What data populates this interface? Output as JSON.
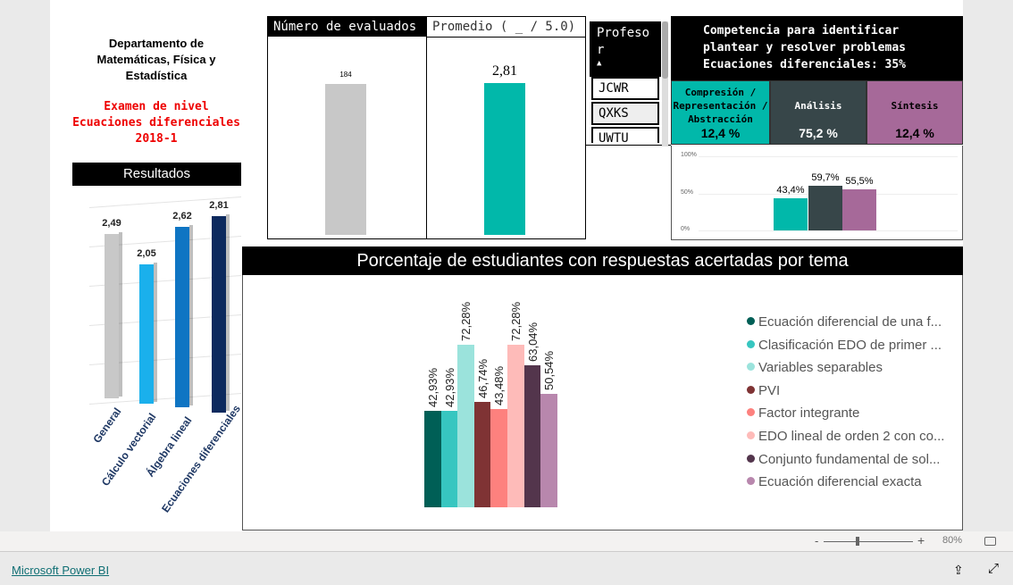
{
  "department": {
    "line1": "Departamento de",
    "line2": "Matemáticas, Física y",
    "line3": "Estadística"
  },
  "exam": {
    "line1": "Examen de nivel",
    "line2": "Ecuaciones diferenciales",
    "line3": "2018-1"
  },
  "results": {
    "title": "Resultados",
    "categories": [
      "General",
      "Cálculo vectorial",
      "Álgebra lineal",
      "Ecuaciones diferenciales"
    ],
    "values": [
      2.49,
      2.05,
      2.62,
      2.81
    ],
    "labels": [
      "2,49",
      "2,05",
      "2,62",
      "2,81"
    ],
    "colors": [
      "#c8c8c8",
      "#1ab0ec",
      "#0f75c3",
      "#0d2a5e"
    ]
  },
  "evaluated": {
    "title": "Número de evaluados",
    "value": "184",
    "color": "#c8c8c8"
  },
  "average": {
    "title": "Promedio ( _ / 5.0)",
    "value": "2,81",
    "color": "#01b8aa"
  },
  "slicer": {
    "title": "Profesor",
    "title_wrap1": "Profeso",
    "title_wrap2": "r",
    "items": [
      "JCWR",
      "QXKS",
      "UWTU"
    ]
  },
  "competence": {
    "line1": "Competencia para identificar",
    "line2": "plantear y resolver problemas",
    "line3": "Ecuaciones diferenciales: 35%",
    "cells": [
      {
        "label": "Compresión / Representación / Abstracción",
        "pct": "12,4 %",
        "color": "#01b8aa"
      },
      {
        "label": "Análisis",
        "pct": "75,2 %",
        "color": "#374649"
      },
      {
        "label": "Síntesis",
        "pct": "12,4 %",
        "color": "#a66999"
      }
    ]
  },
  "chart_data": [
    {
      "type": "bar",
      "categories": [
        "General",
        "Cálculo vectorial",
        "Álgebra lineal",
        "Ecuaciones diferenciales"
      ],
      "values": [
        2.49,
        2.05,
        2.62,
        2.81
      ],
      "title": "Resultados"
    },
    {
      "type": "bar",
      "categories": [
        "Compresión / Representación / Abstracción",
        "Análisis",
        "Síntesis"
      ],
      "values": [
        43.4,
        59.7,
        55.5
      ],
      "labels": [
        "43,4%",
        "59,7%",
        "55,5%"
      ],
      "yticks": [
        "0%",
        "50%",
        "100%"
      ],
      "ylim": [
        0,
        100
      ],
      "colors": [
        "#01b8aa",
        "#374649",
        "#a66999"
      ]
    },
    {
      "type": "bar",
      "title": "Porcentaje de estudiantes con respuestas acertadas por tema",
      "legend": "right",
      "series": [
        {
          "name": "Ecuación diferencial de una f...",
          "value": 42.93,
          "label": "42,93%",
          "color": "#005f56"
        },
        {
          "name": "Clasificación EDO de primer ...",
          "value": 42.93,
          "label": "42,93%",
          "color": "#37c6c0"
        },
        {
          "name": "Variables separables",
          "value": 72.28,
          "label": "72,28%",
          "color": "#9be3dc"
        },
        {
          "name": "PVI",
          "value": 46.74,
          "label": "46,74%",
          "color": "#7f3334"
        },
        {
          "name": "Factor integrante",
          "value": 43.48,
          "label": "43,48%",
          "color": "#fd817e"
        },
        {
          "name": "EDO lineal de orden 2 con co...",
          "value": 72.28,
          "label": "72,28%",
          "color": "#febbb9"
        },
        {
          "name": "Conjunto fundamental de sol...",
          "value": 63.04,
          "label": "63,04%",
          "color": "#53354c"
        },
        {
          "name": "Ecuación diferencial exacta",
          "value": 50.54,
          "label": "50,54%",
          "color": "#b887ad"
        }
      ]
    }
  ],
  "footer": {
    "zoom_minus": "-",
    "zoom_plus": "+",
    "zoom": "80%",
    "brand": "Microsoft Power BI"
  }
}
